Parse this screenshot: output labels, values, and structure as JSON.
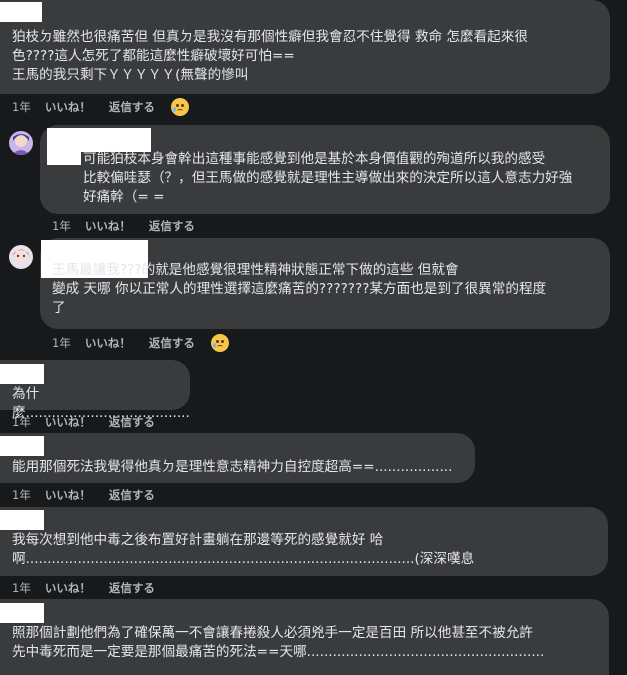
{
  "comments": [
    {
      "text": "狛枝ㄉ雖然也很痛苦但 但真ㄉ是我沒有那個性癖但我會忍不住覺得 救命 怎麼看起來很\n色????這人怎死了都能這麼性癖破壞好可怕==\n王馬的我只剩下ＹＹＹＹＹ(無聲的慘叫",
      "time": "1年",
      "like": "いいね！",
      "reply": "返信する",
      "reaction": "sad-face-emoji"
    },
    {
      "text": "可能狛枝本身會幹出這種事能感覺到他是基於本身價值觀的殉道所以我的感受\n比較偏哇瑟（？，但王馬做的感覺就是理性主導做出來的決定所以這人意志力好強\n好痛幹（= =",
      "time": "1年",
      "like": "いいね！",
      "reply": "返信する"
    },
    {
      "text": "王馬最讓我???的就是他感覺很理性精神狀態正常下做的這些 但就會\n變成 天哪 你以正常人的理性選擇這麼痛苦的???????某方面也是到了很異常的程度\n了",
      "time": "1年",
      "like": "いいね！",
      "reply": "返信する",
      "reaction": "sad-face-emoji"
    },
    {
      "text": "為什麼......................................",
      "time": "1年",
      "like": "いいね！",
      "reply": "返信する"
    },
    {
      "text": "能用那個死法我覺得他真ㄉ是理性意志精神力自控度超高==..................",
      "time": "1年",
      "like": "いいね！",
      "reply": "返信する"
    },
    {
      "text": "我每次想到他中毒之後布置好計畫躺在那邊等死的感覺就好 哈\n啊..........................................................................................(深深嘆息",
      "time": "1年",
      "like": "いいね！",
      "reply": "返信する"
    },
    {
      "text": "照那個計劃他們為了確保萬一不會讓春捲殺人必須兇手一定是百田 所以他甚至不被允許\n先中毒死而是一定要是那個最痛苦的死法==天哪.......................................................",
      "time": "",
      "like": "",
      "reply": ""
    }
  ]
}
